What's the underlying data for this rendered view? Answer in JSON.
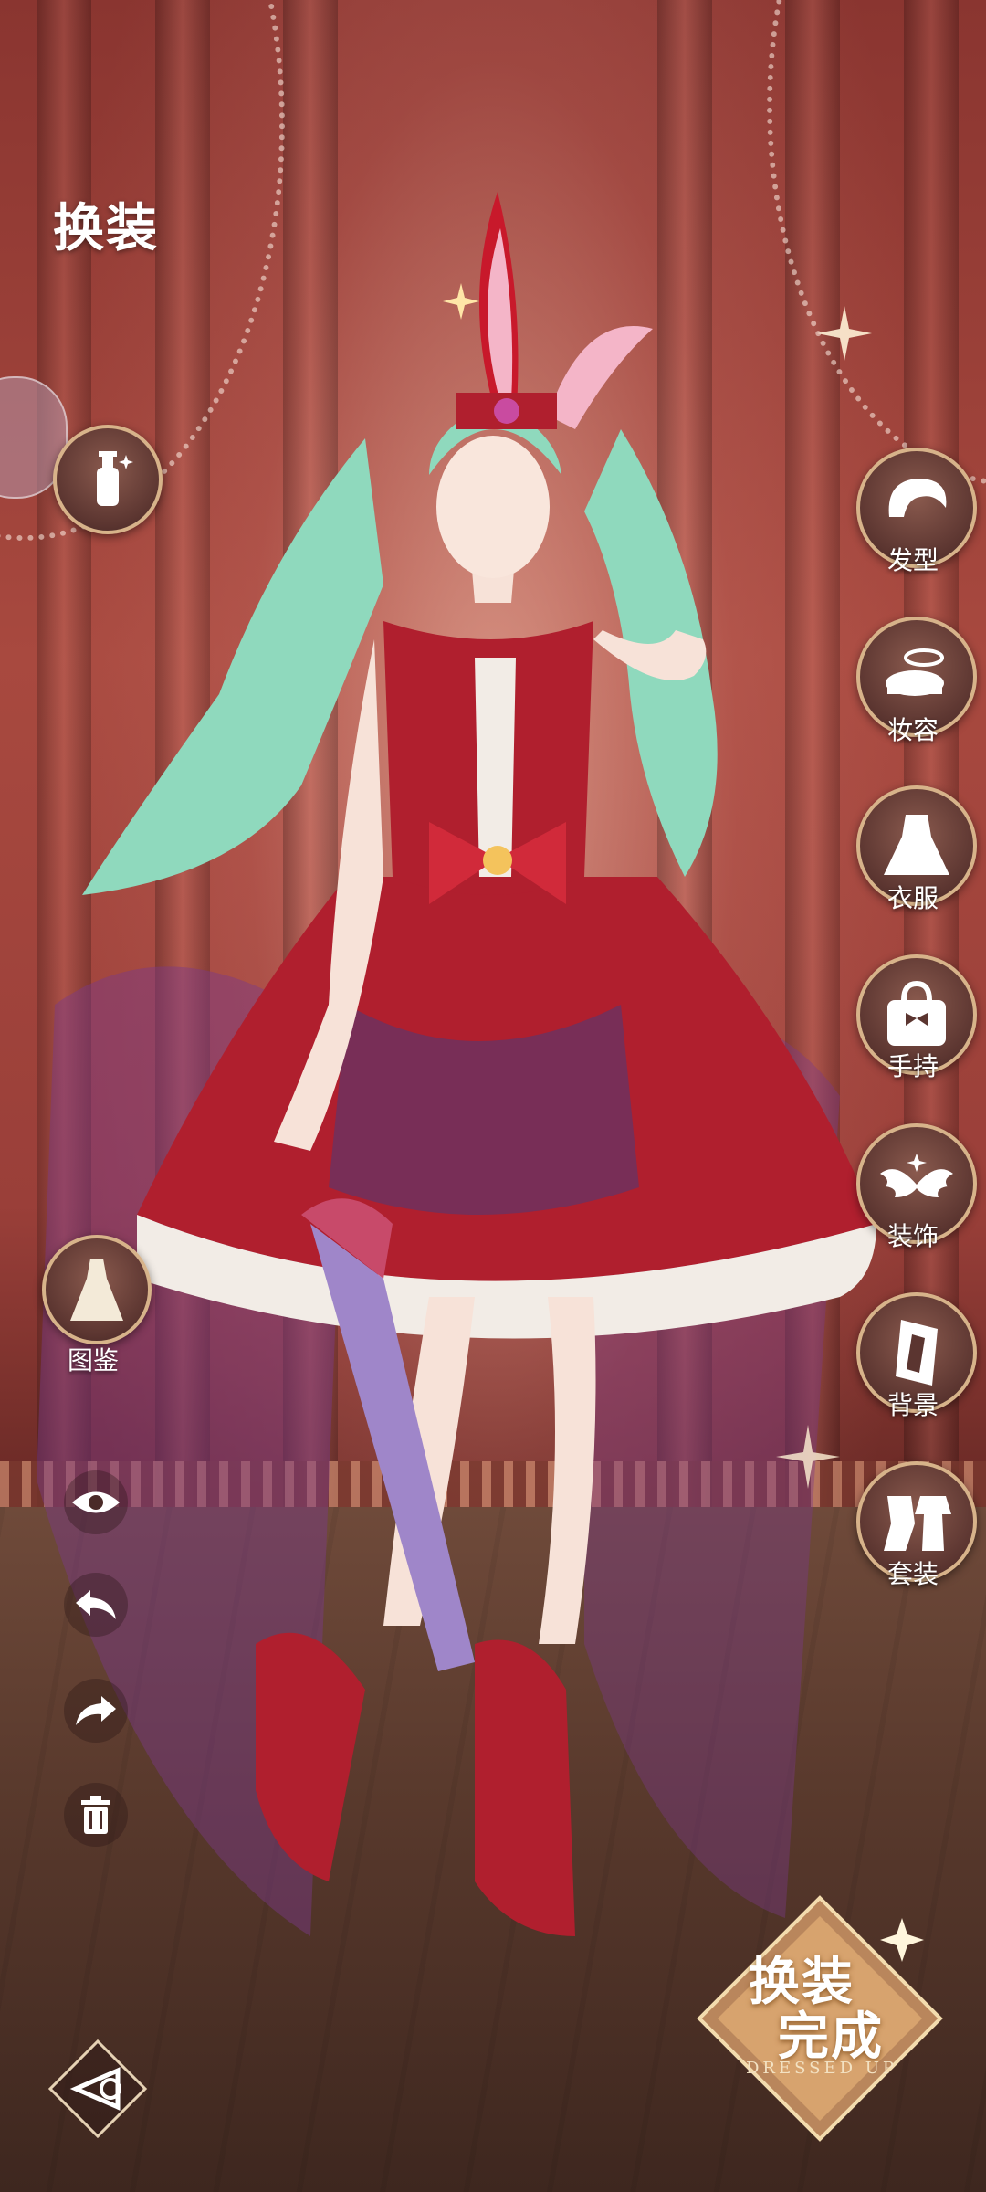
{
  "header": {
    "title": "换装"
  },
  "right_menu": {
    "hairstyle": "发型",
    "makeup": "妆容",
    "clothing": "衣服",
    "handheld": "手持",
    "accessory": "装饰",
    "background": "背景",
    "outfit_set": "套装"
  },
  "left_menu": {
    "gallery": "图鉴"
  },
  "done_button": {
    "line1": "换装",
    "line2": "完成",
    "subtitle": "DRESSED UP"
  },
  "colors": {
    "accent_gold": "#d7b38a",
    "curtain": "#9a3f39",
    "floor": "#5a3a2d"
  }
}
